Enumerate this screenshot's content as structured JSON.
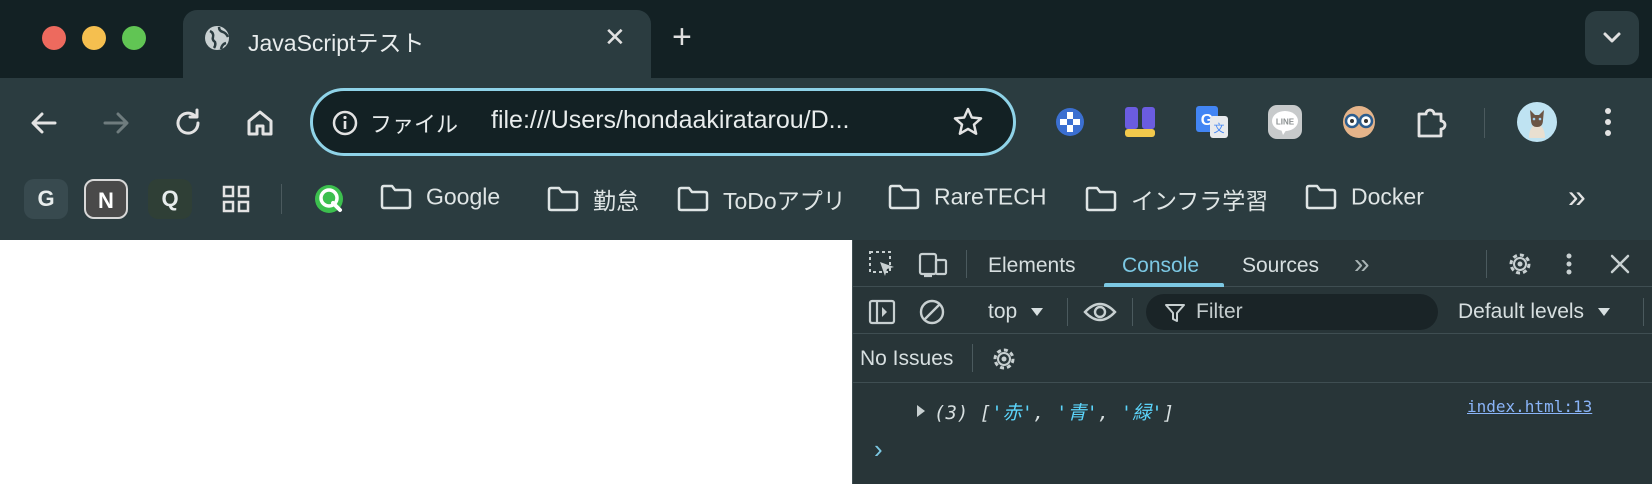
{
  "window": {
    "traffic_lights": [
      "#ed6a5e",
      "#f5bf4f",
      "#61c554"
    ]
  },
  "tab": {
    "title": "JavaScriptテスト",
    "close_glyph": "✕",
    "new_tab_glyph": "+"
  },
  "omnibox": {
    "chip_label": "ファイル",
    "url": "file:///Users/hondaakiratarou/D..."
  },
  "bookmarks": {
    "shortcuts": [
      {
        "letter": "G"
      },
      {
        "letter": "N"
      },
      {
        "letter": "Q"
      }
    ],
    "folders": [
      {
        "label": "Google"
      },
      {
        "label": "勤怠"
      },
      {
        "label": "ToDoアプリ"
      },
      {
        "label": "RareTECH"
      },
      {
        "label": "インフラ学習"
      },
      {
        "label": "Docker"
      }
    ],
    "overflow_glyph": "»"
  },
  "devtools": {
    "tabs": [
      {
        "label": "Elements",
        "active": false
      },
      {
        "label": "Console",
        "active": true
      },
      {
        "label": "Sources",
        "active": false
      }
    ],
    "more_tabs_glyph": "»",
    "context_select": "top",
    "filter_placeholder": "Filter",
    "levels_select": "Default levels",
    "issues_label": "No Issues",
    "console": {
      "log": {
        "count": "(3)",
        "open_bracket": "[",
        "items": [
          "'赤'",
          "'青'",
          "'緑'"
        ],
        "close_bracket": "]",
        "source": "index.html:13"
      },
      "prompt_glyph": "›"
    }
  },
  "colors": {
    "accent": "#7cc8e3",
    "string": "#5cd5fb",
    "link": "#8ab4f8"
  }
}
